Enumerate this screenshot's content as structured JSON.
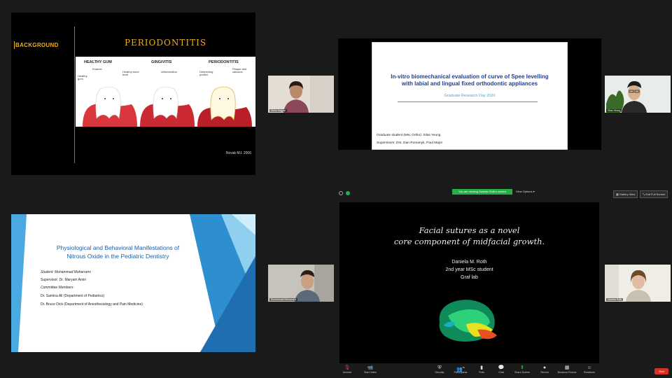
{
  "panel1": {
    "background_label": "BACKGROUND",
    "title": "PERIODONTITIS",
    "columns": [
      "HEALTHY GUM",
      "GINGIVITIS",
      "PERIODONTITIS"
    ],
    "labels": {
      "enamel": "Enamel",
      "healthy_gum": "Healthy gum",
      "healthy_bone": "Healthy bone level",
      "inflammation": "Inflammation",
      "deepening": "Deepening pocket",
      "plaque": "Plaque and calculus"
    },
    "citation": "Novak MJ. 2006"
  },
  "panel2": {
    "title_line1": "In-vitro biomechanical evaluation of curve of Spee levelling",
    "title_line2": "with labial and lingual fixed orthodontic appliances",
    "subtitle": "Graduate Research Day 2020",
    "student": "Graduate student (Msc Ortho): Silas Yeung",
    "supervisors": "Supervisors: Drs. Dan Romanyk, Paul Major"
  },
  "panel3": {
    "title_line1": "Physiological and Behavioral Manifestations of",
    "title_line2": "Nitrous Oxide in the Pediatric Dentistry",
    "student": "Student: Mohammad Moharrami",
    "supervisor": "Supervisor: Dr. Maryam Amin",
    "committee_heading": "Committee Members:",
    "member1": "Dr. Samina Ali (Department of Pediatrics)",
    "member2": "Dr. Bruce Dick (Department of Anesthesiology and Pain Medicine)"
  },
  "panel4": {
    "title_line1": "Facial sutures as a novel",
    "title_line2": "core component of midfacial growth.",
    "name": "Daniela M. Roth",
    "degree": "2nd year MSc student",
    "lab": "Graf lab"
  },
  "participants": {
    "p1": "Disha Nagpal",
    "p2": "Silas Yeung",
    "p3": "Mohammad Moharrami",
    "p4": "Daniela Roth"
  },
  "topbar": {
    "share_notice": "You are viewing Daniela Roth's screen",
    "view_options": "View Options",
    "gallery_view": "Gallery View",
    "exit_fullscreen": "Exit Full Screen"
  },
  "toolbar": {
    "unmute": "Unmute",
    "start_video": "Start Video",
    "security": "Security",
    "participants": "Participants",
    "participants_count": "52",
    "polls": "Polls",
    "chat": "Chat",
    "share_screen": "Share Screen",
    "record": "Record",
    "breakout": "Breakout Rooms",
    "reactions": "Reactions",
    "end": "End"
  },
  "colors": {
    "accent_gold": "#f0b020",
    "title_blue": "#1f3f8f",
    "share_green": "#27ae48",
    "end_red": "#d93025"
  }
}
